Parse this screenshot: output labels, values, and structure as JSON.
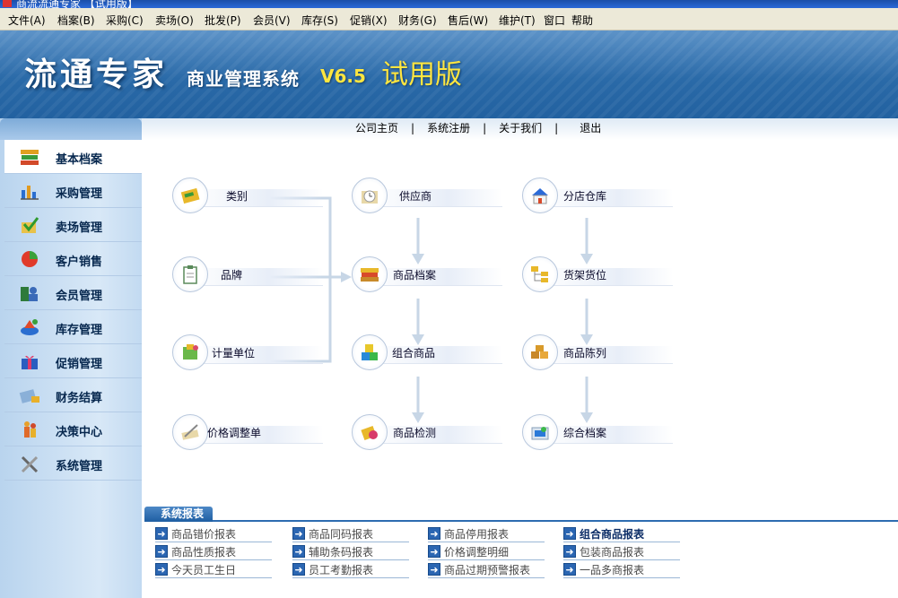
{
  "window": {
    "title": "商流流通专家 【试用版】"
  },
  "menu": [
    "文件(A)",
    "档案(B)",
    "采购(C)",
    "卖场(O)",
    "批发(P)",
    "会员(V)",
    "库存(S)",
    "促销(X)",
    "财务(G)",
    "售后(W)",
    "维护(T)",
    "窗口",
    "帮助"
  ],
  "banner": {
    "logo": "流通专家",
    "subtitle": "商业管理系统",
    "version": "V6.5",
    "trial": "试用版"
  },
  "toplinks": [
    "公司主页",
    "系统注册",
    "关于我们",
    "退出"
  ],
  "sidebar": [
    {
      "label": "基本档案",
      "icon": "books-icon"
    },
    {
      "label": "采购管理",
      "icon": "purchase-chart-icon"
    },
    {
      "label": "卖场管理",
      "icon": "store-check-icon"
    },
    {
      "label": "客户销售",
      "icon": "pie-chart-icon"
    },
    {
      "label": "会员管理",
      "icon": "members-icon"
    },
    {
      "label": "库存管理",
      "icon": "inventory-icon"
    },
    {
      "label": "促销管理",
      "icon": "gift-icon"
    },
    {
      "label": "财务结算",
      "icon": "calculator-icon"
    },
    {
      "label": "决策中心",
      "icon": "decision-people-icon"
    },
    {
      "label": "系统管理",
      "icon": "tools-icon"
    }
  ],
  "flow": {
    "category": "类别",
    "brand": "品牌",
    "unit": "计量单位",
    "price_adjust": "价格调整单",
    "supplier": "供应商",
    "product": "商品档案",
    "combo": "组合商品",
    "inspection": "商品检测",
    "warehouse": "分店仓库",
    "shelf": "货架货位",
    "display": "商品陈列",
    "comprehensive": "综合档案"
  },
  "reports": {
    "title": "系统报表",
    "col1": [
      "商品错价报表",
      "商品性质报表",
      "今天员工生日"
    ],
    "col2": [
      "商品同码报表",
      "辅助条码报表",
      "员工考勤报表"
    ],
    "col3": [
      "商品停用报表",
      "价格调整明细",
      "商品过期预警报表"
    ],
    "col4": [
      "组合商品报表",
      "包装商品报表",
      "一品多商报表"
    ]
  }
}
